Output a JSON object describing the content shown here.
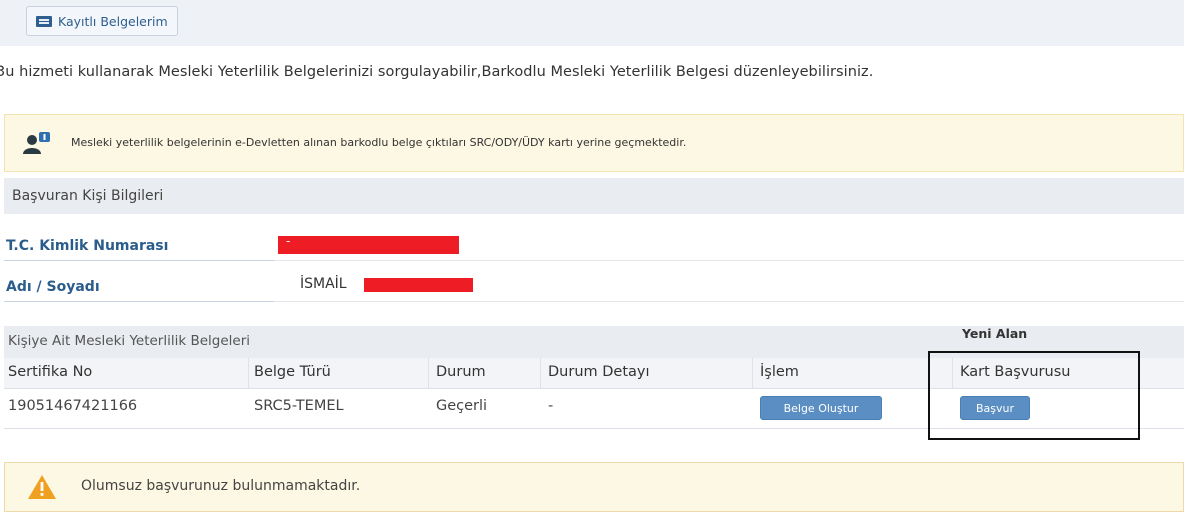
{
  "header": {
    "tab_label": "Kayıtlı Belgelerim",
    "tab_icon": "document-list-icon"
  },
  "intro_text": "3u hizmeti kullanarak Mesleki Yeterlilik Belgelerinizi sorgulayabilir,Barkodlu Mesleki Yeterlilik Belgesi düzenleyebilirsiniz.",
  "info_notice": {
    "icon": "user-info-icon",
    "text": "Mesleki yeterlilik belgelerinin e-Devletten alınan barkodlu belge çıktıları SRC/ODY/ÜDY kartı yerine geçmektedir."
  },
  "applicant": {
    "section_title": "Başvuran Kişi Bilgileri",
    "tc_label": "T.C. Kimlik Numarası",
    "tc_value": "-",
    "name_label": "Adı / Soyadı",
    "name_value": "İSMAİL"
  },
  "certificates": {
    "caption": "Kişiye Ait Mesleki Yeterlilik Belgeleri",
    "new_area_label": "Yeni Alan",
    "columns": [
      "Sertifika No",
      "Belge Türü",
      "Durum",
      "Durum Detayı",
      "İşlem",
      "Kart Başvurusu"
    ],
    "rows": [
      {
        "certificate_no": "19051467421166",
        "type": "SRC5-TEMEL",
        "status": "Geçerli",
        "status_detail": "-",
        "action_label": "Belge Oluştur",
        "card_action_label": "Başvur"
      }
    ]
  },
  "warning_notice": {
    "icon": "warning-triangle-icon",
    "text": "Olumsuz başvurunuz bulunmamaktadır."
  },
  "colors": {
    "accent_blue": "#5b8fc3",
    "label_blue": "#2b5d8c",
    "notice_bg": "#fcf8e3",
    "redaction": "#ee1c25",
    "warning_orange": "#f0a020"
  }
}
